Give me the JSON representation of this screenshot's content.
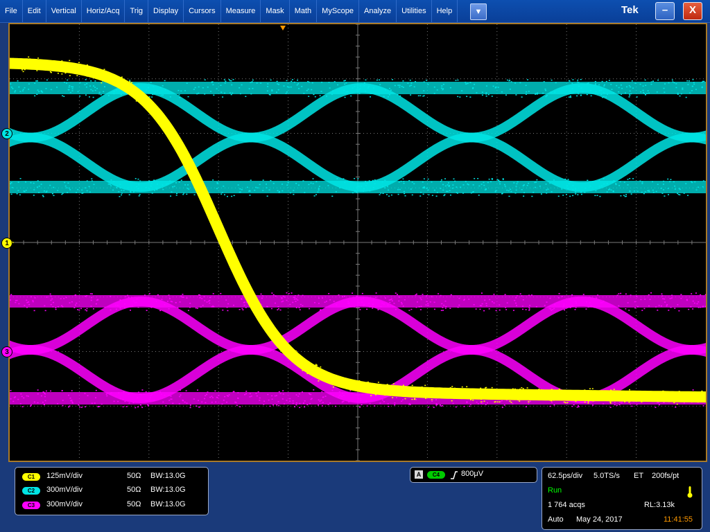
{
  "menu": {
    "items": [
      "File",
      "Edit",
      "Vertical",
      "Horiz/Acq",
      "Trig",
      "Display",
      "Cursors",
      "Measure",
      "Mask",
      "Math",
      "MyScope",
      "Analyze",
      "Utilities",
      "Help"
    ],
    "dropdown_icon": "▼",
    "vendor_logo": "Tek",
    "minimize_icon": "–",
    "close_icon": "X"
  },
  "channels": [
    {
      "marker": "2",
      "pill": "C1",
      "scale": "125mV/div",
      "impedance": "50Ω",
      "bandwidth": "BW:13.0G",
      "color": "#ffff00"
    },
    {
      "marker": "1",
      "pill": "C2",
      "scale": "300mV/div",
      "impedance": "50Ω",
      "bandwidth": "BW:13.0G",
      "color": "#00e5e5"
    },
    {
      "marker": "3",
      "pill": "C3",
      "scale": "300mV/div",
      "impedance": "50Ω",
      "bandwidth": "BW:13.0G",
      "color": "#ff00ff"
    }
  ],
  "trigger": {
    "mode_badge": "A",
    "source": "C4",
    "slope_icon": "rising-edge",
    "level": "800μV",
    "color_source": "#00cc00"
  },
  "timebase": {
    "horizontal": "62.5ps/div",
    "sample_rate": "5.0TS/s",
    "mode": "ET",
    "resolution": "200fs/pt",
    "run_state": "Run",
    "acquisitions": "1 764 acqs",
    "record_length": "RL:3.13k",
    "trigger_mode": "Auto",
    "date": "May 24, 2017",
    "time": "11:41:55",
    "run_color": "#00ff00",
    "time_color": "#ff9900"
  },
  "colors": {
    "grid": "#7a7a7a",
    "frame": "#a87a28",
    "ch1": "#ffff00",
    "ch2": "#00e5e5",
    "ch3": "#ff00ff"
  }
}
